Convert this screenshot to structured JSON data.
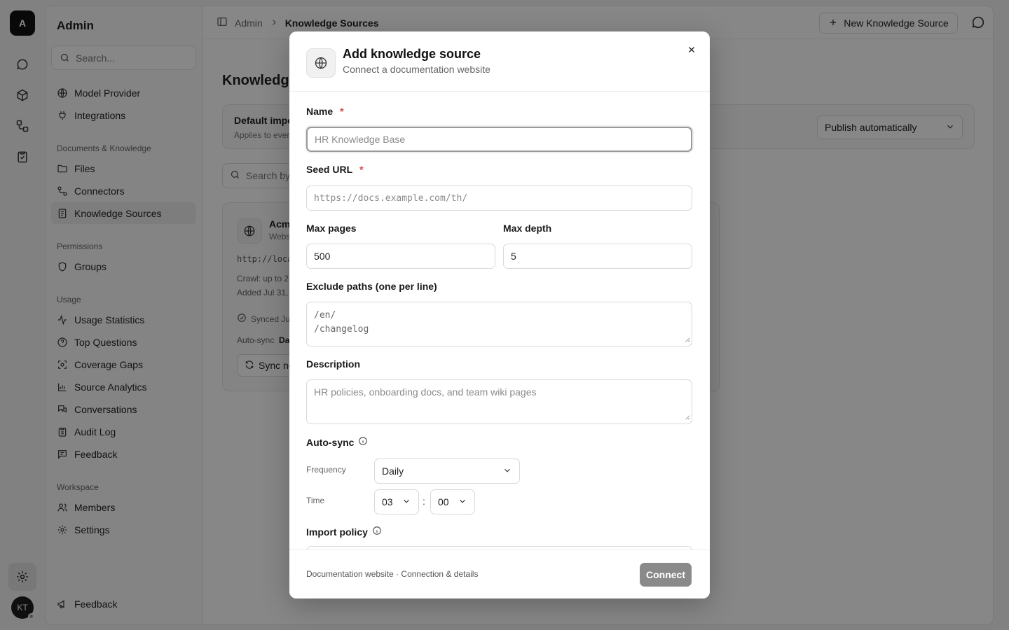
{
  "rail": {
    "logo": "A",
    "avatar": "KT",
    "icons": [
      "chat-icon",
      "cube-icon",
      "workflow-icon",
      "clipboard-check-icon",
      "gear-icon"
    ]
  },
  "sidebar": {
    "title": "Admin",
    "search_placeholder": "Search...",
    "items_top": [
      {
        "label": "Model Provider",
        "icon": "globe-icon"
      },
      {
        "label": "Integrations",
        "icon": "plug-icon"
      }
    ],
    "section_docs": "Documents & Knowledge",
    "items_docs": [
      {
        "label": "Files",
        "icon": "folder-icon"
      },
      {
        "label": "Connectors",
        "icon": "connector-icon"
      },
      {
        "label": "Knowledge Sources",
        "icon": "book-icon",
        "active": true
      }
    ],
    "section_permissions": "Permissions",
    "items_permissions": [
      {
        "label": "Groups",
        "icon": "shield-icon"
      }
    ],
    "section_usage": "Usage",
    "items_usage": [
      {
        "label": "Usage Statistics",
        "icon": "activity-icon"
      },
      {
        "label": "Top Questions",
        "icon": "help-circle-icon"
      },
      {
        "label": "Coverage Gaps",
        "icon": "scan-icon"
      },
      {
        "label": "Source Analytics",
        "icon": "bar-chart-icon"
      },
      {
        "label": "Conversations",
        "icon": "messages-icon"
      },
      {
        "label": "Audit Log",
        "icon": "clipboard-icon"
      },
      {
        "label": "Feedback",
        "icon": "message-square-icon"
      }
    ],
    "section_workspace": "Workspace",
    "items_workspace": [
      {
        "label": "Members",
        "icon": "users-icon"
      },
      {
        "label": "Settings",
        "icon": "gear-icon"
      }
    ],
    "footer_item": {
      "label": "Feedback",
      "icon": "megaphone-icon"
    }
  },
  "topbar": {
    "crumb_parent": "Admin",
    "crumb_current": "Knowledge Sources",
    "new_button": "New Knowledge Source"
  },
  "main": {
    "page_title": "Knowledge",
    "policy_title": "Default impo",
    "policy_sub": "Applies to ever",
    "policy_select": "Publish automatically",
    "search_placeholder": "Search by",
    "source": {
      "name": "Acm",
      "type": "Webs",
      "url": "http://loca",
      "crawl": "Crawl: up to 2",
      "added": "Added Jul 31,",
      "synced": "Synced Ju",
      "auto_label": "Auto-sync",
      "auto_value": "Da",
      "sync_button": "Sync no"
    }
  },
  "modal": {
    "title": "Add knowledge source",
    "subtitle": "Connect a documentation website",
    "name_label": "Name",
    "name_placeholder": "HR Knowledge Base",
    "seed_label": "Seed URL",
    "seed_placeholder": "https://docs.example.com/th/",
    "max_pages_label": "Max pages",
    "max_pages_value": "500",
    "max_depth_label": "Max depth",
    "max_depth_value": "5",
    "exclude_label": "Exclude paths (one per line)",
    "exclude_lines": [
      "/en/",
      "/changelog"
    ],
    "description_label": "Description",
    "description_placeholder": "HR policies, onboarding docs, and team wiki pages",
    "autosync_label": "Auto-sync",
    "frequency_label": "Frequency",
    "frequency_value": "Daily",
    "time_label": "Time",
    "time_hour": "03",
    "time_sep": ":",
    "time_minute": "00",
    "import_policy_label": "Import policy",
    "footer_text": "Documentation website · Connection & details",
    "connect_button": "Connect"
  },
  "colors": {
    "overlay": "#000000",
    "required": "#d64545",
    "connect_disabled": "#8a8a8a"
  }
}
